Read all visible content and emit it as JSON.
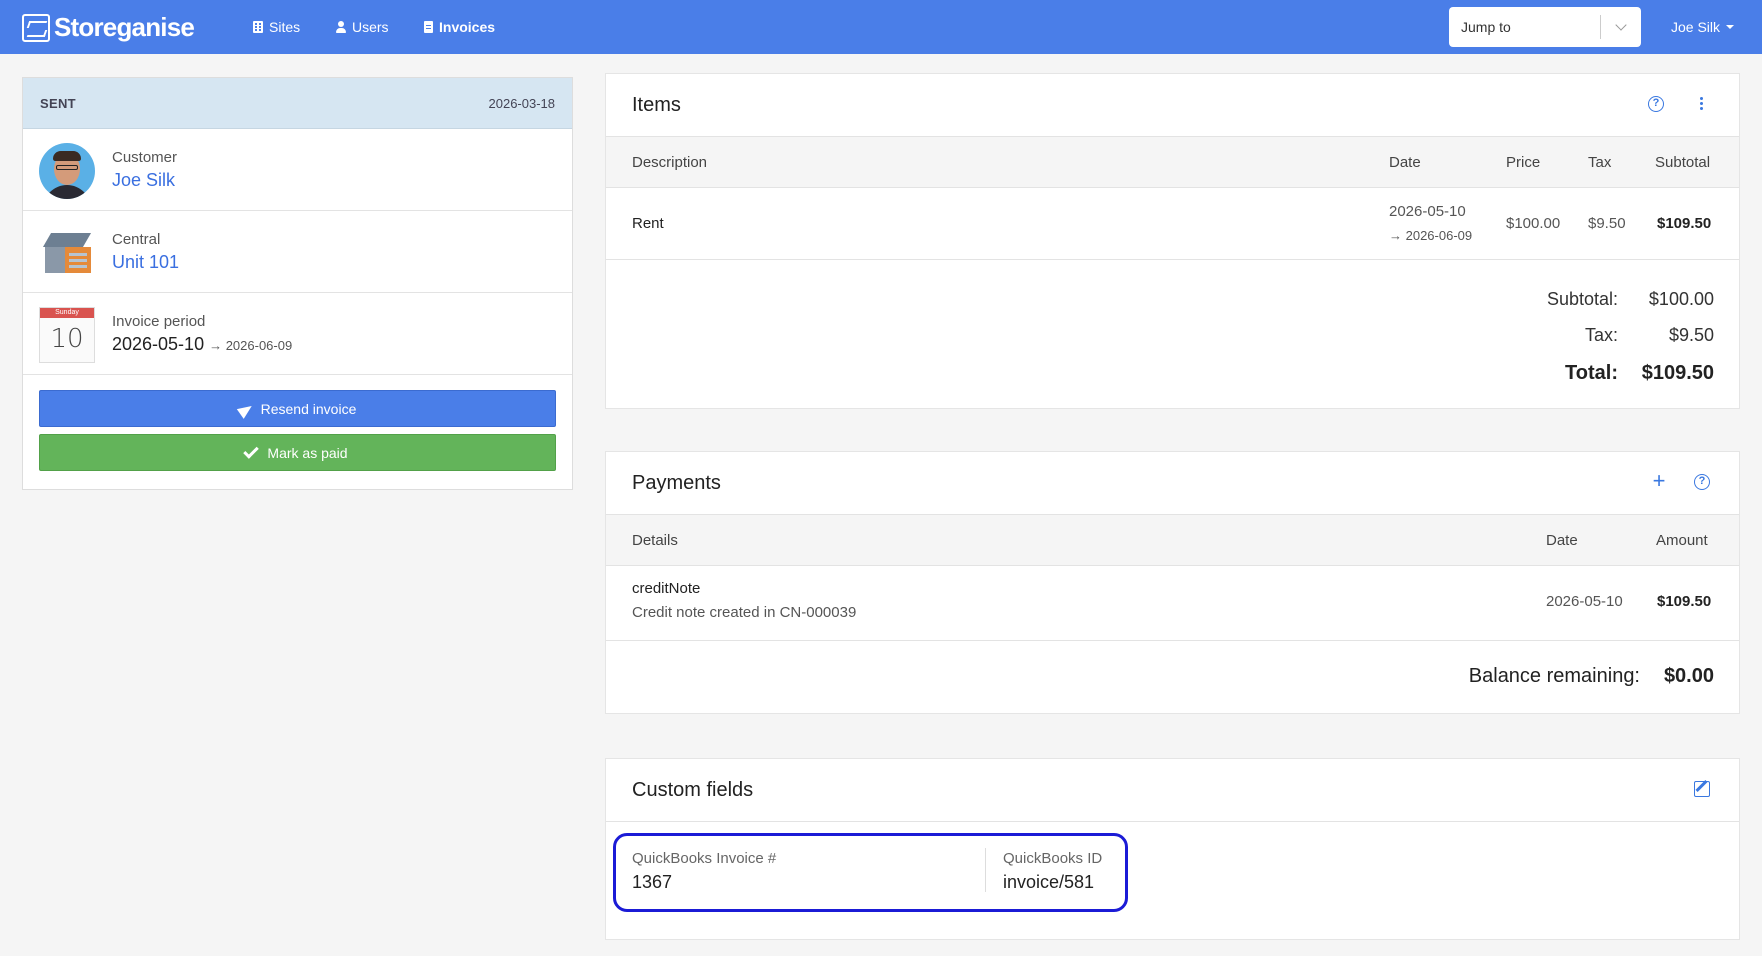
{
  "nav": {
    "brand": "Storeganise",
    "items": [
      {
        "label": "Sites",
        "icon": "building-icon"
      },
      {
        "label": "Users",
        "icon": "user-icon"
      },
      {
        "label": "Invoices",
        "icon": "file-icon"
      }
    ],
    "jump_placeholder": "Jump to",
    "user_name": "Joe Silk"
  },
  "invoice": {
    "status": "SENT",
    "date": "2026-03-18",
    "customer_label": "Customer",
    "customer_name": "Joe Silk",
    "site_label": "Central",
    "unit_name": "Unit 101",
    "period_label": "Invoice period",
    "period_start": "2026-05-10",
    "period_end": "→ 2026-06-09",
    "calendar_weekday": "Sunday",
    "calendar_day": "10",
    "resend_label": "Resend invoice",
    "mark_paid_label": "Mark as paid"
  },
  "items": {
    "title": "Items",
    "headers": {
      "description": "Description",
      "date": "Date",
      "price": "Price",
      "tax": "Tax",
      "subtotal": "Subtotal"
    },
    "rows": [
      {
        "description": "Rent",
        "date_start": "2026-05-10",
        "date_end": "→ 2026-06-09",
        "price": "$100.00",
        "tax": "$9.50",
        "subtotal": "$109.50"
      }
    ],
    "totals": {
      "subtotal_label": "Subtotal:",
      "subtotal_value": "$100.00",
      "tax_label": "Tax:",
      "tax_value": "$9.50",
      "total_label": "Total:",
      "total_value": "$109.50"
    }
  },
  "payments": {
    "title": "Payments",
    "headers": {
      "details": "Details",
      "date": "Date",
      "amount": "Amount"
    },
    "rows": [
      {
        "type": "creditNote",
        "description": "Credit note created in CN-000039",
        "date": "2026-05-10",
        "amount": "$109.50"
      }
    ],
    "balance_label": "Balance remaining:",
    "balance_value": "$0.00"
  },
  "custom_fields": {
    "title": "Custom fields",
    "fields": [
      {
        "label": "QuickBooks Invoice #",
        "value": "1367"
      },
      {
        "label": "QuickBooks ID",
        "value": "invoice/581"
      }
    ]
  },
  "colors": {
    "navbar": "#4a7ee8",
    "primary": "#4a7ee8",
    "success": "#63b45a",
    "highlight": "#1b1bd6"
  }
}
